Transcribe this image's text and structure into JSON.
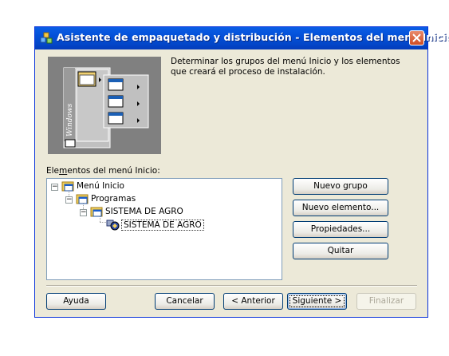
{
  "window": {
    "title": "Asistente de empaquetado y distribución - Elementos del menú Inicio",
    "description": "Determinar los grupos del menú Inicio y los elementos que creará el proceso de instalación.",
    "illustration_text": "Windows"
  },
  "tree": {
    "label": "Elementos del menú Inicio:",
    "label_prefix": "Ele",
    "label_mnemonic": "m",
    "label_rest": "entos del menú Inicio:",
    "nodes": [
      {
        "label": "Menú Inicio",
        "level": 0
      },
      {
        "label": "Programas",
        "level": 1
      },
      {
        "label": "SISTEMA DE AGRO",
        "level": 2
      },
      {
        "label": "SISTEMA DE AGRO",
        "level": 3,
        "selected": true
      }
    ]
  },
  "buttons": {
    "new_group": "Nuevo grupo",
    "new_item": "Nuevo elemento...",
    "properties": "Propiedades...",
    "remove": "Quitar",
    "help": "Ayuda",
    "cancel": "Cancelar",
    "back": "< Anterior",
    "next": "Siguiente >",
    "finish": "Finalizar"
  },
  "colors": {
    "titlebar": "#0450d8",
    "dialog_bg": "#ece9d8",
    "close_button": "#d14e24"
  }
}
